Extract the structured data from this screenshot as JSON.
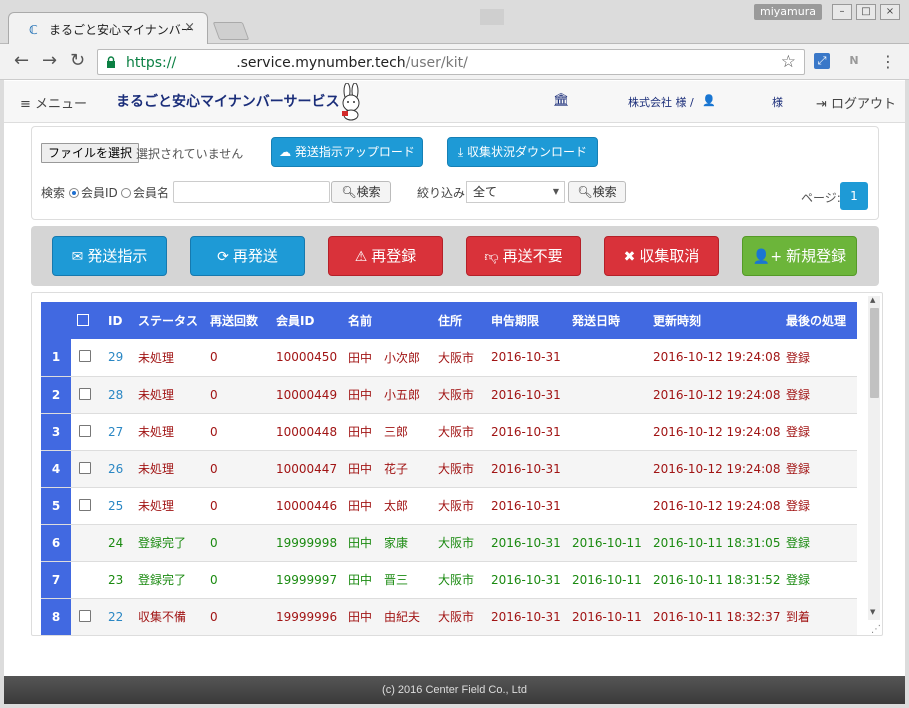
{
  "browser": {
    "tab_title": "まるごと安心マイナンバー",
    "tab_close": "×",
    "user_badge": "miyamura",
    "win_min": "–",
    "win_max": "□",
    "win_close": "×",
    "url_scheme": "https://",
    "url_host": ".service.mynumber.tech",
    "url_path": "/user/kit/",
    "ext2_label": "N"
  },
  "header": {
    "menu_label": "≡ メニュー",
    "brand": "まるごと安心マイナンバーサービス",
    "company": "株式会社 様 /",
    "user_suffix": "様",
    "logout_label": "ログアウト"
  },
  "filter": {
    "file_button": "ファイルを選択",
    "file_status": "選択されていません",
    "upload_button": "発送指示アップロード",
    "download_button": "収集状況ダウンロード",
    "search_label": "検索",
    "radio_member_id": "会員ID",
    "radio_member_name": "会員名",
    "search_input_value": "",
    "search_button": "検索",
    "narrow_label": "絞り込み",
    "narrow_select_value": "全て",
    "narrow_search_button": "検索",
    "page_label": "ページ:",
    "page_number": "1"
  },
  "actions": {
    "send": "発送指示",
    "resend": "再発送",
    "reregister": "再登録",
    "no_resend": "再送不要",
    "cancel": "収集取消",
    "new_register": "新規登録"
  },
  "table": {
    "headers": [
      "",
      "",
      "ID",
      "ステータス",
      "再送回数",
      "会員ID",
      "名前",
      "住所",
      "申告期限",
      "発送日時",
      "更新時刻",
      "最後の処理"
    ],
    "rows": [
      {
        "idx": "1",
        "id": "29",
        "status": "未処理",
        "resend": "0",
        "member_id": "10000450",
        "last": "田中",
        "first": "小次郎",
        "address": "大阪市",
        "deadline": "2016-10-31",
        "sent": "",
        "updated": "2016-10-12 19:24:08",
        "action": "登録"
      },
      {
        "idx": "2",
        "id": "28",
        "status": "未処理",
        "resend": "0",
        "member_id": "10000449",
        "last": "田中",
        "first": "小五郎",
        "address": "大阪市",
        "deadline": "2016-10-31",
        "sent": "",
        "updated": "2016-10-12 19:24:08",
        "action": "登録"
      },
      {
        "idx": "3",
        "id": "27",
        "status": "未処理",
        "resend": "0",
        "member_id": "10000448",
        "last": "田中",
        "first": "三郎",
        "address": "大阪市",
        "deadline": "2016-10-31",
        "sent": "",
        "updated": "2016-10-12 19:24:08",
        "action": "登録"
      },
      {
        "idx": "4",
        "id": "26",
        "status": "未処理",
        "resend": "0",
        "member_id": "10000447",
        "last": "田中",
        "first": "花子",
        "address": "大阪市",
        "deadline": "2016-10-31",
        "sent": "",
        "updated": "2016-10-12 19:24:08",
        "action": "登録"
      },
      {
        "idx": "5",
        "id": "25",
        "status": "未処理",
        "resend": "0",
        "member_id": "10000446",
        "last": "田中",
        "first": "太郎",
        "address": "大阪市",
        "deadline": "2016-10-31",
        "sent": "",
        "updated": "2016-10-12 19:24:08",
        "action": "登録"
      },
      {
        "idx": "6",
        "id": "24",
        "status": "登録完了",
        "resend": "0",
        "member_id": "19999998",
        "last": "田中",
        "first": "家康",
        "address": "大阪市",
        "deadline": "2016-10-31",
        "sent": "2016-10-11",
        "updated": "2016-10-11 18:31:05",
        "action": "登録"
      },
      {
        "idx": "7",
        "id": "23",
        "status": "登録完了",
        "resend": "0",
        "member_id": "19999997",
        "last": "田中",
        "first": "晋三",
        "address": "大阪市",
        "deadline": "2016-10-31",
        "sent": "2016-10-11",
        "updated": "2016-10-11 18:31:52",
        "action": "登録"
      },
      {
        "idx": "8",
        "id": "22",
        "status": "収集不備",
        "resend": "0",
        "member_id": "19999996",
        "last": "田中",
        "first": "由紀夫",
        "address": "大阪市",
        "deadline": "2016-10-31",
        "sent": "2016-10-11",
        "updated": "2016-10-11 18:32:37",
        "action": "到着"
      }
    ]
  },
  "footer": {
    "copyright": "(c) 2016 Center Field Co., Ltd"
  },
  "colors": {
    "header_blue": "#4169e1",
    "action_blue": "#1e9ad6",
    "action_red": "#d9323a",
    "action_green": "#6cb53a",
    "text_red": "#a11414",
    "text_green": "#1a8a10"
  }
}
